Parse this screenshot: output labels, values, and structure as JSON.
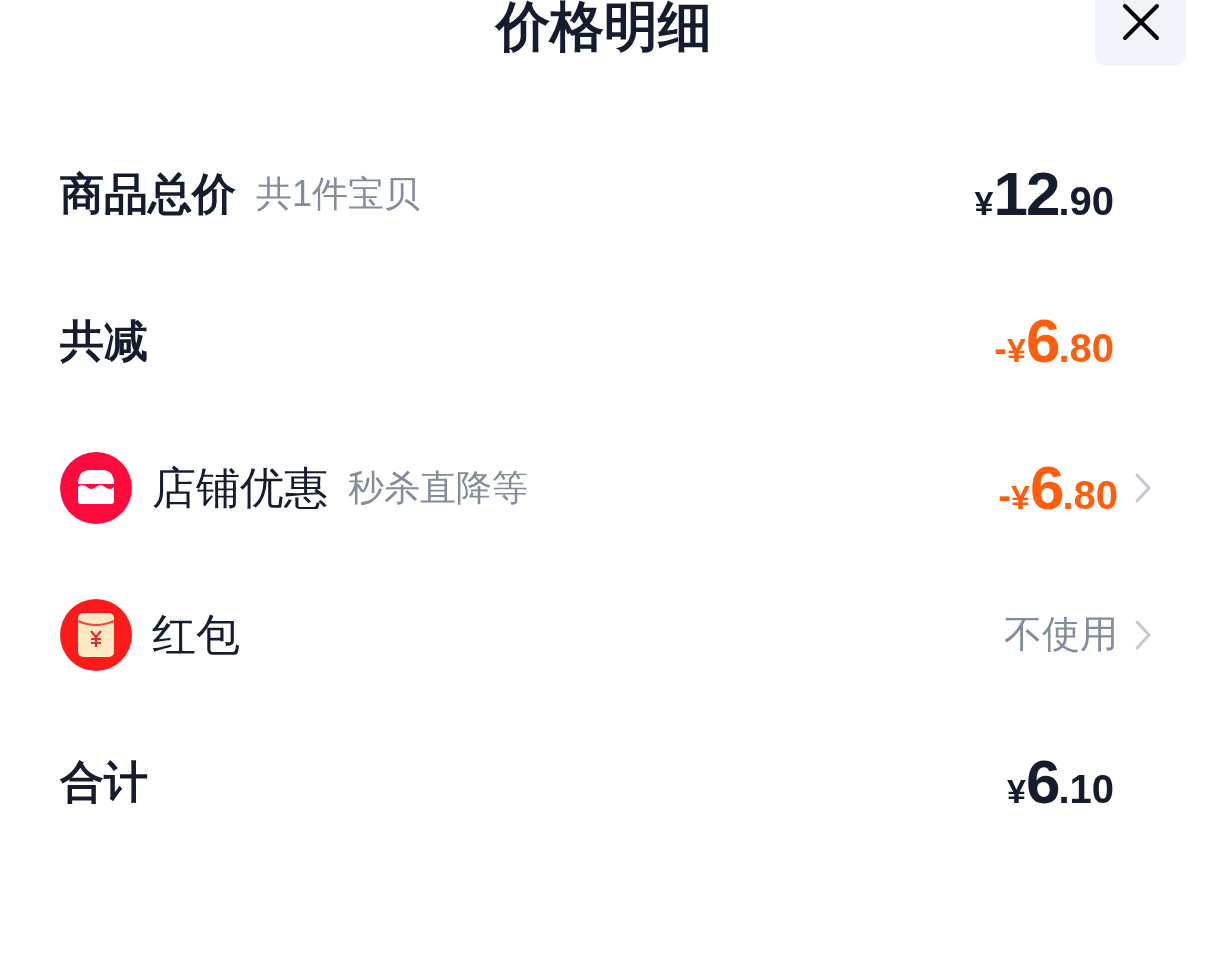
{
  "title": "价格明细",
  "rows": [
    {
      "kind": "total",
      "label": "商品总价",
      "sublabel": "共1件宝贝",
      "price": {
        "currency": "¥",
        "integer": "12",
        "decimal": ".90"
      },
      "negative": false,
      "chevron": false
    },
    {
      "kind": "total",
      "label": "共减",
      "price": {
        "sign": "-",
        "currency": "¥",
        "integer": "6",
        "decimal": ".80"
      },
      "negative": true,
      "chevron": false
    },
    {
      "kind": "shop",
      "label": "店铺优惠",
      "sublabel": "秒杀直降等",
      "price": {
        "sign": "-",
        "currency": "¥",
        "integer": "6",
        "decimal": ".80"
      },
      "negative": true,
      "chevron": true
    },
    {
      "kind": "packet",
      "label": "红包",
      "value": "不使用",
      "chevron": true
    },
    {
      "kind": "total",
      "label": "合计",
      "price": {
        "currency": "¥",
        "integer": "6",
        "decimal": ".10"
      },
      "negative": false,
      "chevron": false
    }
  ]
}
